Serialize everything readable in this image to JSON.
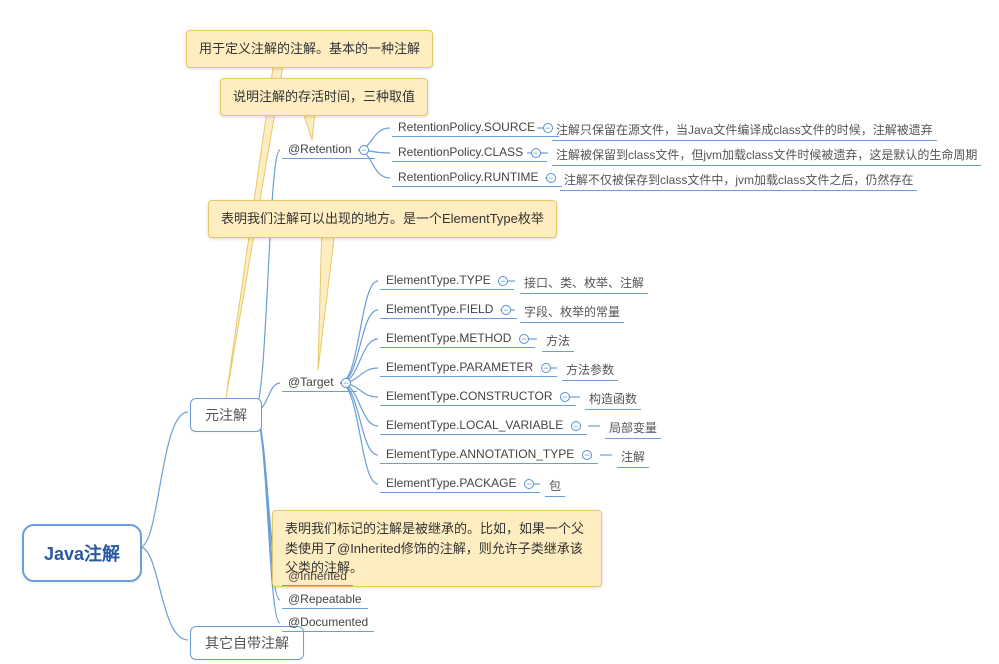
{
  "root": "Java注解",
  "branches": {
    "meta": "元注解",
    "other": "其它自带注解"
  },
  "meta_children": {
    "retention": "@Retention",
    "target": "@Target",
    "inherited": "@Inherited",
    "repeatable": "@Repeatable",
    "documented": "@Documented"
  },
  "retention_items": [
    {
      "name": "RetentionPolicy.SOURCE",
      "desc": "注解只保留在源文件，当Java文件编译成class文件的时候，注解被遗弃"
    },
    {
      "name": "RetentionPolicy.CLASS",
      "desc": "注解被保留到class文件，但jvm加载class文件时候被遗弃，这是默认的生命周期"
    },
    {
      "name": "RetentionPolicy.RUNTIME",
      "desc": "注解不仅被保存到class文件中，jvm加载class文件之后，仍然存在"
    }
  ],
  "target_items": [
    {
      "name": "ElementType.TYPE",
      "desc": "接口、类、枚举、注解"
    },
    {
      "name": "ElementType.FIELD",
      "desc": "字段、枚举的常量"
    },
    {
      "name": "ElementType.METHOD",
      "desc": "方法"
    },
    {
      "name": "ElementType.PARAMETER",
      "desc": "方法参数"
    },
    {
      "name": "ElementType.CONSTRUCTOR",
      "desc": "构造函数"
    },
    {
      "name": "ElementType.LOCAL_VARIABLE",
      "desc": "局部变量"
    },
    {
      "name": "ElementType.ANNOTATION_TYPE",
      "desc": "注解"
    },
    {
      "name": "ElementType.PACKAGE",
      "desc": "包"
    }
  ],
  "annotations": {
    "basic": "用于定义注解的注解。基本的一种注解",
    "retention_note": "说明注解的存活时间，三种取值",
    "target_note": "表明我们注解可以出现的地方。是一个ElementType枚举",
    "inherited_note": "表明我们标记的注解是被继承的。比如，如果一个父类使用了@Inherited修饰的注解，则允许子类继承该父类的注解。"
  },
  "toggle_glyph": "−"
}
